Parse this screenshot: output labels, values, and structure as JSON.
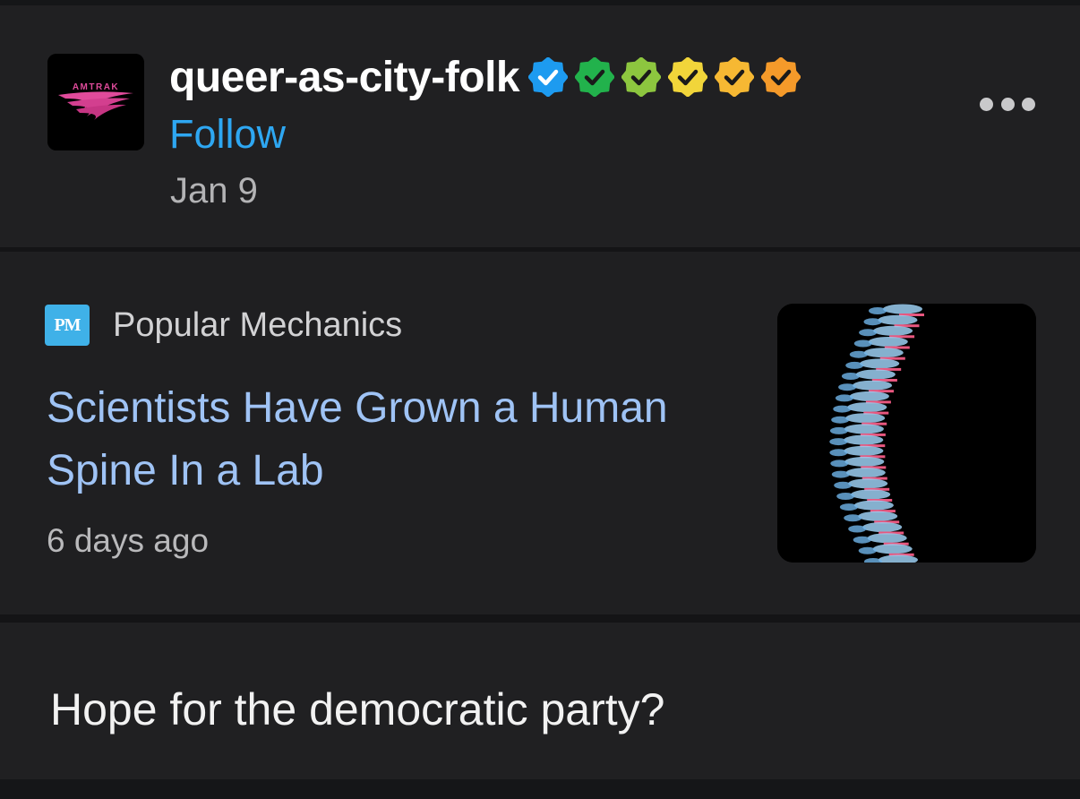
{
  "post": {
    "avatar": {
      "label": "AMTRAK",
      "icon": "amtrak-logo-icon",
      "accent": "#e04b9b"
    },
    "username": "queer-as-city-folk",
    "badges": [
      {
        "icon": "verified-check-icon",
        "color": "#1d9bf0"
      },
      {
        "icon": "verified-check-icon",
        "color": "#22b24c"
      },
      {
        "icon": "verified-check-icon",
        "color": "#8dc63f"
      },
      {
        "icon": "verified-check-icon",
        "color": "#f1d53a"
      },
      {
        "icon": "verified-check-icon",
        "color": "#f6b833"
      },
      {
        "icon": "verified-check-icon",
        "color": "#f59a2a"
      }
    ],
    "follow_label": "Follow",
    "date": "Jan 9",
    "more_icon": "more-options-icon"
  },
  "card": {
    "source_logo": "PM",
    "source_name": "Popular Mechanics",
    "headline": "Scientists Have Grown a Human Spine In a Lab",
    "time_ago": "6 days ago",
    "thumbnail_icon": "spine-xray-icon"
  },
  "caption": "Hope for the democratic party?",
  "colors": {
    "background": "#202022",
    "link": "#2ea7f2",
    "headline": "#9fc3f5"
  }
}
